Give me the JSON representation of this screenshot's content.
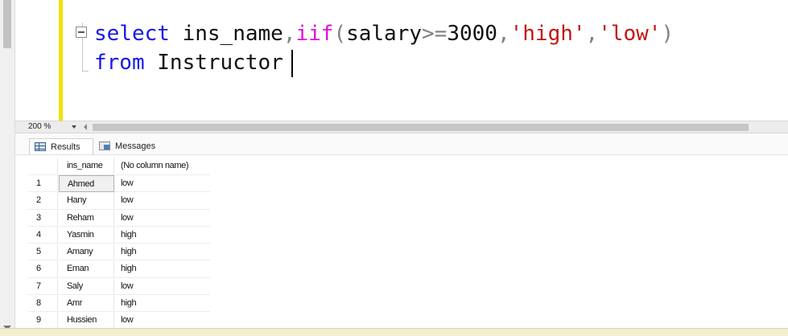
{
  "editor": {
    "line1": {
      "keyword": "select",
      "space1": " ",
      "column": "ins_name",
      "comma1": ",",
      "func": "iif",
      "paren_open": "(",
      "arg": "salary",
      "op": ">=",
      "num": "3000",
      "comma2": ",",
      "str1": "'high'",
      "comma3": ",",
      "str2": "'low'",
      "paren_close": ")"
    },
    "line2": {
      "keyword": "from",
      "space": " ",
      "table": "Instructor"
    }
  },
  "zoom": {
    "value": "200 %"
  },
  "tabs": {
    "results": "Results",
    "messages": "Messages"
  },
  "grid": {
    "columns": [
      "ins_name",
      "(No column name)"
    ],
    "rows": [
      {
        "n": "1",
        "name": "Ahmed",
        "val": "low"
      },
      {
        "n": "2",
        "name": "Hany",
        "val": "low"
      },
      {
        "n": "3",
        "name": "Reham",
        "val": "low"
      },
      {
        "n": "4",
        "name": "Yasmin",
        "val": "high"
      },
      {
        "n": "5",
        "name": "Amany",
        "val": "high"
      },
      {
        "n": "6",
        "name": "Eman",
        "val": "high"
      },
      {
        "n": "7",
        "name": "Saly",
        "val": "low"
      },
      {
        "n": "8",
        "name": "Amr",
        "val": "high"
      },
      {
        "n": "9",
        "name": "Hussien",
        "val": "low"
      }
    ]
  },
  "colors": {
    "keyword": "#1818e6",
    "function": "#e20ed6",
    "string": "#c41414",
    "operator": "#808080",
    "selection_margin": "#f2e100"
  }
}
